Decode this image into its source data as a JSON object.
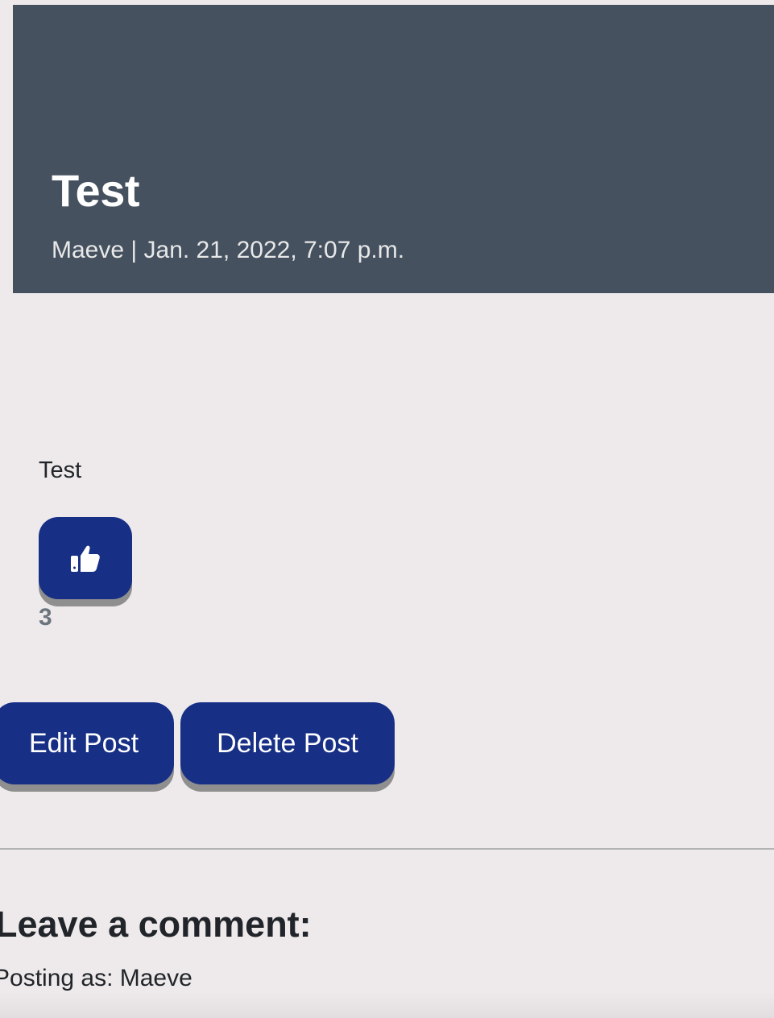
{
  "post": {
    "title": "Test",
    "author": "Maeve",
    "separator": "|",
    "date": "Jan. 21, 2022, 7:07 p.m.",
    "meta": "Maeve | Jan. 21, 2022, 7:07 p.m.",
    "body": "Test"
  },
  "likes": {
    "icon": "thumbs-up-icon",
    "count": "3"
  },
  "actions": {
    "edit_label": "Edit Post",
    "delete_label": "Delete Post"
  },
  "comments": {
    "heading": "Leave a comment:",
    "posting_as": "Posting as: Maeve"
  },
  "colors": {
    "masthead_bg": "#45515f",
    "button_bg": "#172f85",
    "page_bg": "#eeeaec",
    "count_text": "#6c757d"
  }
}
